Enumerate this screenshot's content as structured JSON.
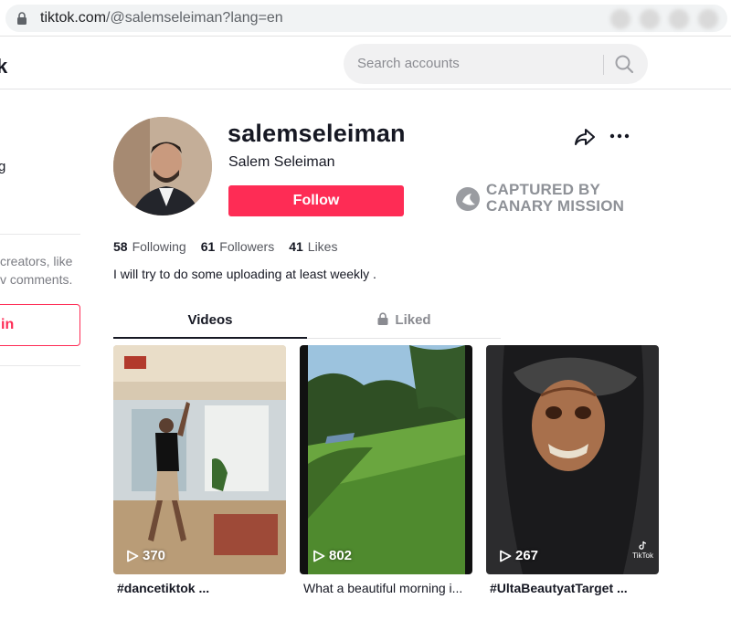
{
  "browser": {
    "url_host": "tiktok.com",
    "url_path": "/@salemseleiman?lang=en"
  },
  "header": {
    "logo_fragment": "k",
    "search_placeholder": "Search accounts"
  },
  "sidebar": {
    "partial_item": "g",
    "prompt_text_line1": "creators, like",
    "prompt_text_line2": "v comments.",
    "login_label": "in"
  },
  "profile": {
    "username": "salemseleiman",
    "display_name": "Salem Seleiman",
    "follow_label": "Follow",
    "stats": {
      "following_count": "58",
      "following_label": "Following",
      "followers_count": "61",
      "followers_label": "Followers",
      "likes_count": "41",
      "likes_label": "Likes"
    },
    "bio": "I will try to do some uploading at least weekly ."
  },
  "watermark": {
    "line1": "CAPTURED BY",
    "line2": "CANARY MISSION"
  },
  "tabs": {
    "videos": "Videos",
    "liked": "Liked"
  },
  "videos": [
    {
      "views": "370",
      "caption": "#dancetiktok ..."
    },
    {
      "views": "802",
      "caption": "What a beautiful morning i..."
    },
    {
      "views": "267",
      "caption": "#UltaBeautyatTarget ..."
    }
  ],
  "video_badge": "TikTok",
  "colors": {
    "accent": "#fe2c55",
    "text": "#161823",
    "muted": "#8a8b91"
  }
}
